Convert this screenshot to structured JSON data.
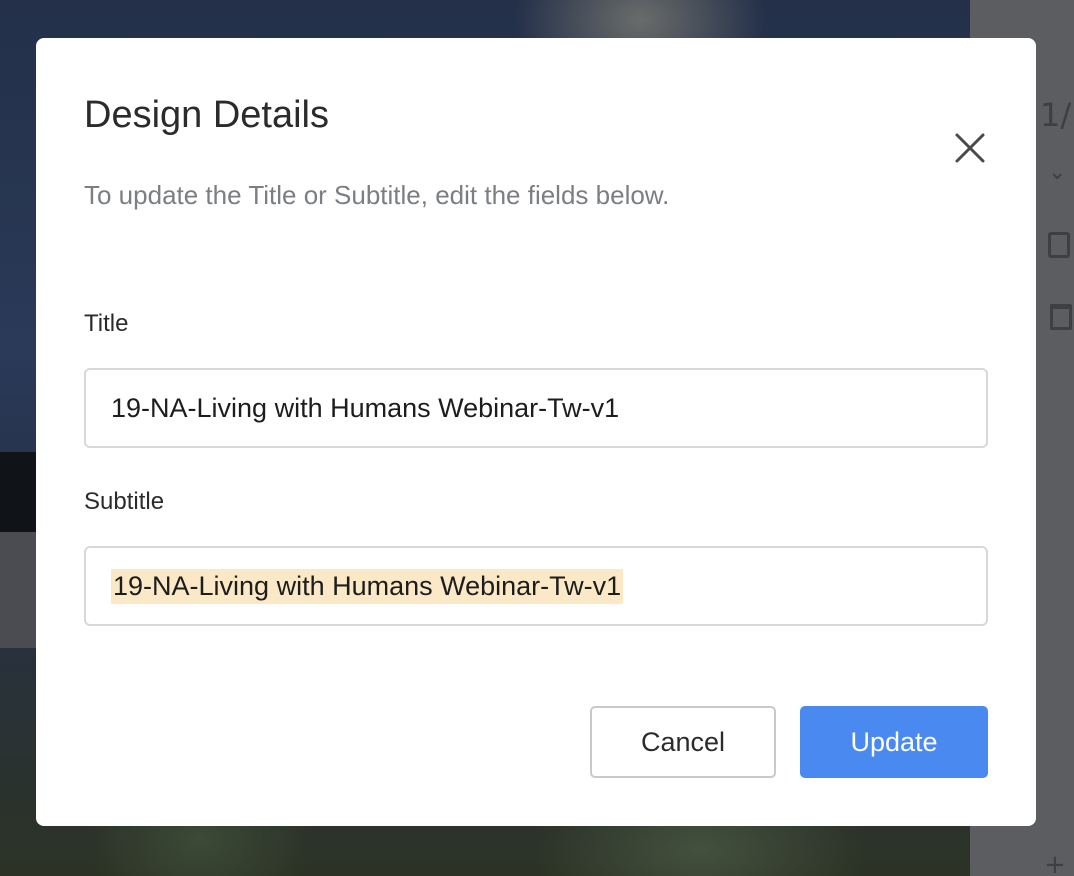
{
  "dialog": {
    "title": "Design Details",
    "description": "To update the Title or Subtitle, edit the fields below.",
    "close_icon": "close-icon"
  },
  "fields": {
    "title": {
      "label": "Title",
      "value": "19-NA-Living with Humans Webinar-Tw-v1"
    },
    "subtitle": {
      "label": "Subtitle",
      "value": "19-NA-Living with Humans Webinar-Tw-v1",
      "selected": true
    }
  },
  "actions": {
    "cancel_label": "Cancel",
    "update_label": "Update"
  },
  "colors": {
    "accent": "#4a8af0",
    "selection_highlight": "#fbe8c6",
    "overlay": "#1f2636"
  },
  "background_rail": {
    "icons": [
      "page-indicator-icon",
      "chevron-down-icon",
      "duplicate-icon",
      "trash-icon",
      "add-icon"
    ]
  }
}
